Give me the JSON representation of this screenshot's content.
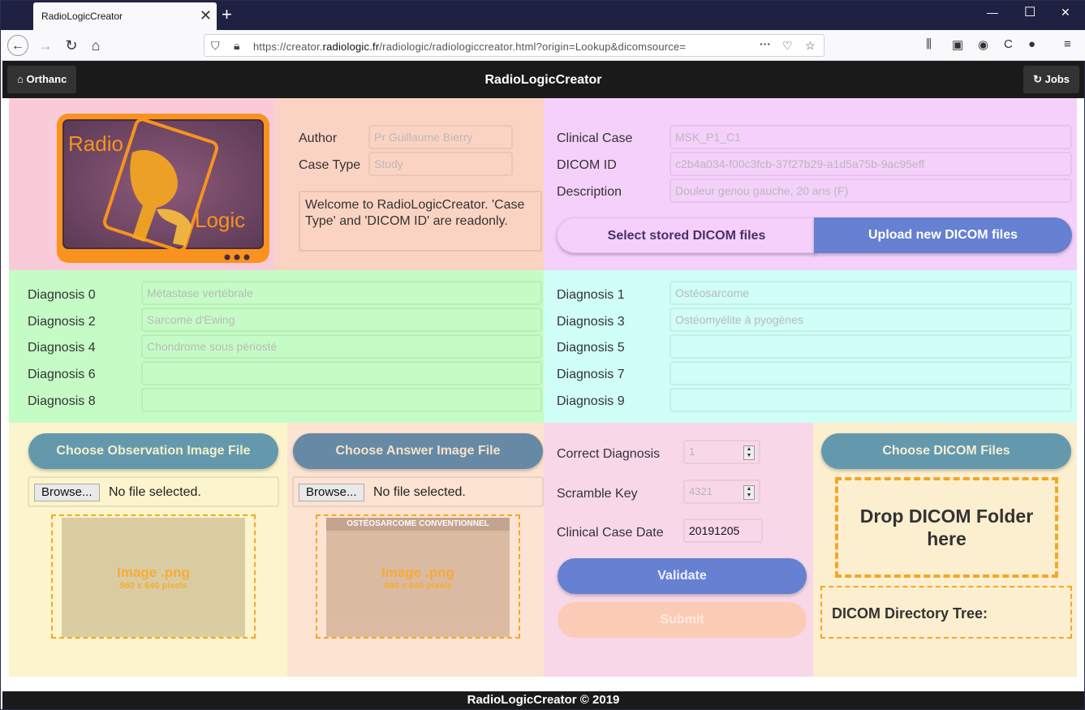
{
  "browser": {
    "tab_title": "RadioLogicCreator",
    "url_prefix": "https://creator.",
    "url_domain": "radiologic.fr",
    "url_suffix": "/radiologic/radiologiccreator.html?origin=Lookup&dicomsource="
  },
  "header": {
    "title": "RadioLogicCreator",
    "home_button": "Orthanc",
    "jobs_button": "Jobs"
  },
  "logo": {
    "word1": "Radio",
    "word2": "Logic"
  },
  "meta": {
    "author_label": "Author",
    "author_value": "Pr Guillaume Bierry",
    "case_type_label": "Case Type",
    "case_type_value": "Study",
    "welcome_text": "Welcome to RadioLogicCreator. 'Case Type' and 'DICOM ID' are readonly."
  },
  "case": {
    "clinical_case_label": "Clinical Case",
    "clinical_case_value": "MSK_P1_C1",
    "dicom_id_label": "DICOM ID",
    "dicom_id_value": "c2b4a034-f00c3fcb-37f27b29-a1d5a75b-9ac95eff",
    "description_label": "Description",
    "description_value": "Douleur genou gauche, 20 ans (F)",
    "select_stored": "Select stored DICOM files",
    "upload_new": "Upload new DICOM files"
  },
  "diagnoses_left": [
    {
      "label": "Diagnosis 0",
      "value": "Métastase vertébrale"
    },
    {
      "label": "Diagnosis 2",
      "value": "Sarcome d'Ewing"
    },
    {
      "label": "Diagnosis 4",
      "value": "Chondrome sous périosté"
    },
    {
      "label": "Diagnosis 6",
      "value": ""
    },
    {
      "label": "Diagnosis 8",
      "value": ""
    }
  ],
  "diagnoses_right": [
    {
      "label": "Diagnosis 1",
      "value": "Ostéosarcome"
    },
    {
      "label": "Diagnosis 3",
      "value": "Ostéomyélite à pyogènes"
    },
    {
      "label": "Diagnosis 5",
      "value": ""
    },
    {
      "label": "Diagnosis 7",
      "value": ""
    },
    {
      "label": "Diagnosis 9",
      "value": ""
    }
  ],
  "observation": {
    "button": "Choose Observation Image File",
    "browse": "Browse...",
    "no_file": "No file selected.",
    "placeholder_title": "Image .png",
    "placeholder_size": "960 x 640 pixels"
  },
  "answer": {
    "button": "Choose Answer Image File",
    "browse": "Browse...",
    "no_file": "No file selected.",
    "placeholder_title": "Image .png",
    "placeholder_size": "960 x 640 pixels",
    "slide_heading": "OSTÉOSARCOME CONVENTIONNEL"
  },
  "form": {
    "correct_label": "Correct Diagnosis",
    "correct_value": "1",
    "scramble_label": "Scramble Key",
    "scramble_value": "4321",
    "date_label": "Clinical Case Date",
    "date_value": "20191205",
    "validate": "Validate",
    "submit": "Submit"
  },
  "dicom": {
    "button": "Choose DICOM Files",
    "drop_text": "Drop DICOM Folder here",
    "tree_label": "DICOM Directory Tree:"
  },
  "footer": {
    "text": "RadioLogicCreator © 2019"
  },
  "colors": {
    "pink": "#f9cbd9",
    "peach": "#fbd3c2",
    "lilac": "#f5d0fb",
    "green": "#c5fcc6",
    "cyan": "#cffff6",
    "cream": "#fcf4cc",
    "light_peach": "#fde3d2",
    "pink2": "#f8d8e8",
    "cream2": "#fbefd0",
    "blue_button": "#6680d2",
    "teal_button": "#6499ad",
    "orange": "#f6a623"
  }
}
